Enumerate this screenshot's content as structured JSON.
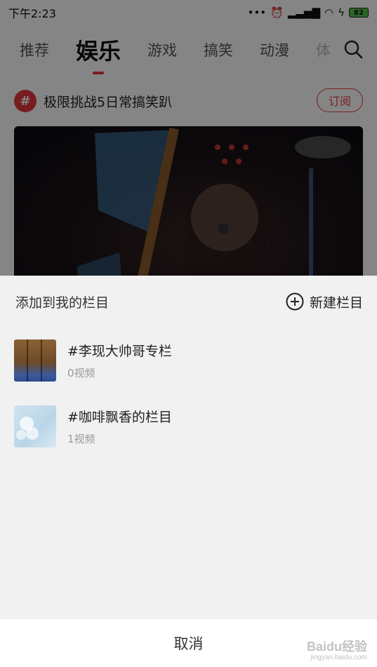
{
  "status_bar": {
    "time": "下午2:23",
    "signal_dots": "•••",
    "battery_level": "82"
  },
  "tabs": [
    {
      "label": "推荐",
      "active": false
    },
    {
      "label": "娱乐",
      "active": true
    },
    {
      "label": "游戏",
      "active": false
    },
    {
      "label": "搞笑",
      "active": false
    },
    {
      "label": "动漫",
      "active": false
    },
    {
      "label": "体",
      "active": false
    }
  ],
  "topic": {
    "badge": "#",
    "title": "极限挑战5日常搞笑趴",
    "subscribe_label": "订阅"
  },
  "sheet": {
    "title": "添加到我的栏目",
    "new_column_label": "新建栏目",
    "columns": [
      {
        "name": "#李现大帅哥专栏",
        "count": "0视频"
      },
      {
        "name": "#咖啡飘香的栏目",
        "count": "1视频"
      }
    ],
    "cancel_label": "取消"
  },
  "watermark": {
    "text": "Baidu经验",
    "subtext": "jingyan.baidu.com"
  },
  "colors": {
    "accent": "#e4393c",
    "sheet_bg": "#f1f1f1",
    "dim_overlay": "rgba(0,0,0,0.48)"
  }
}
